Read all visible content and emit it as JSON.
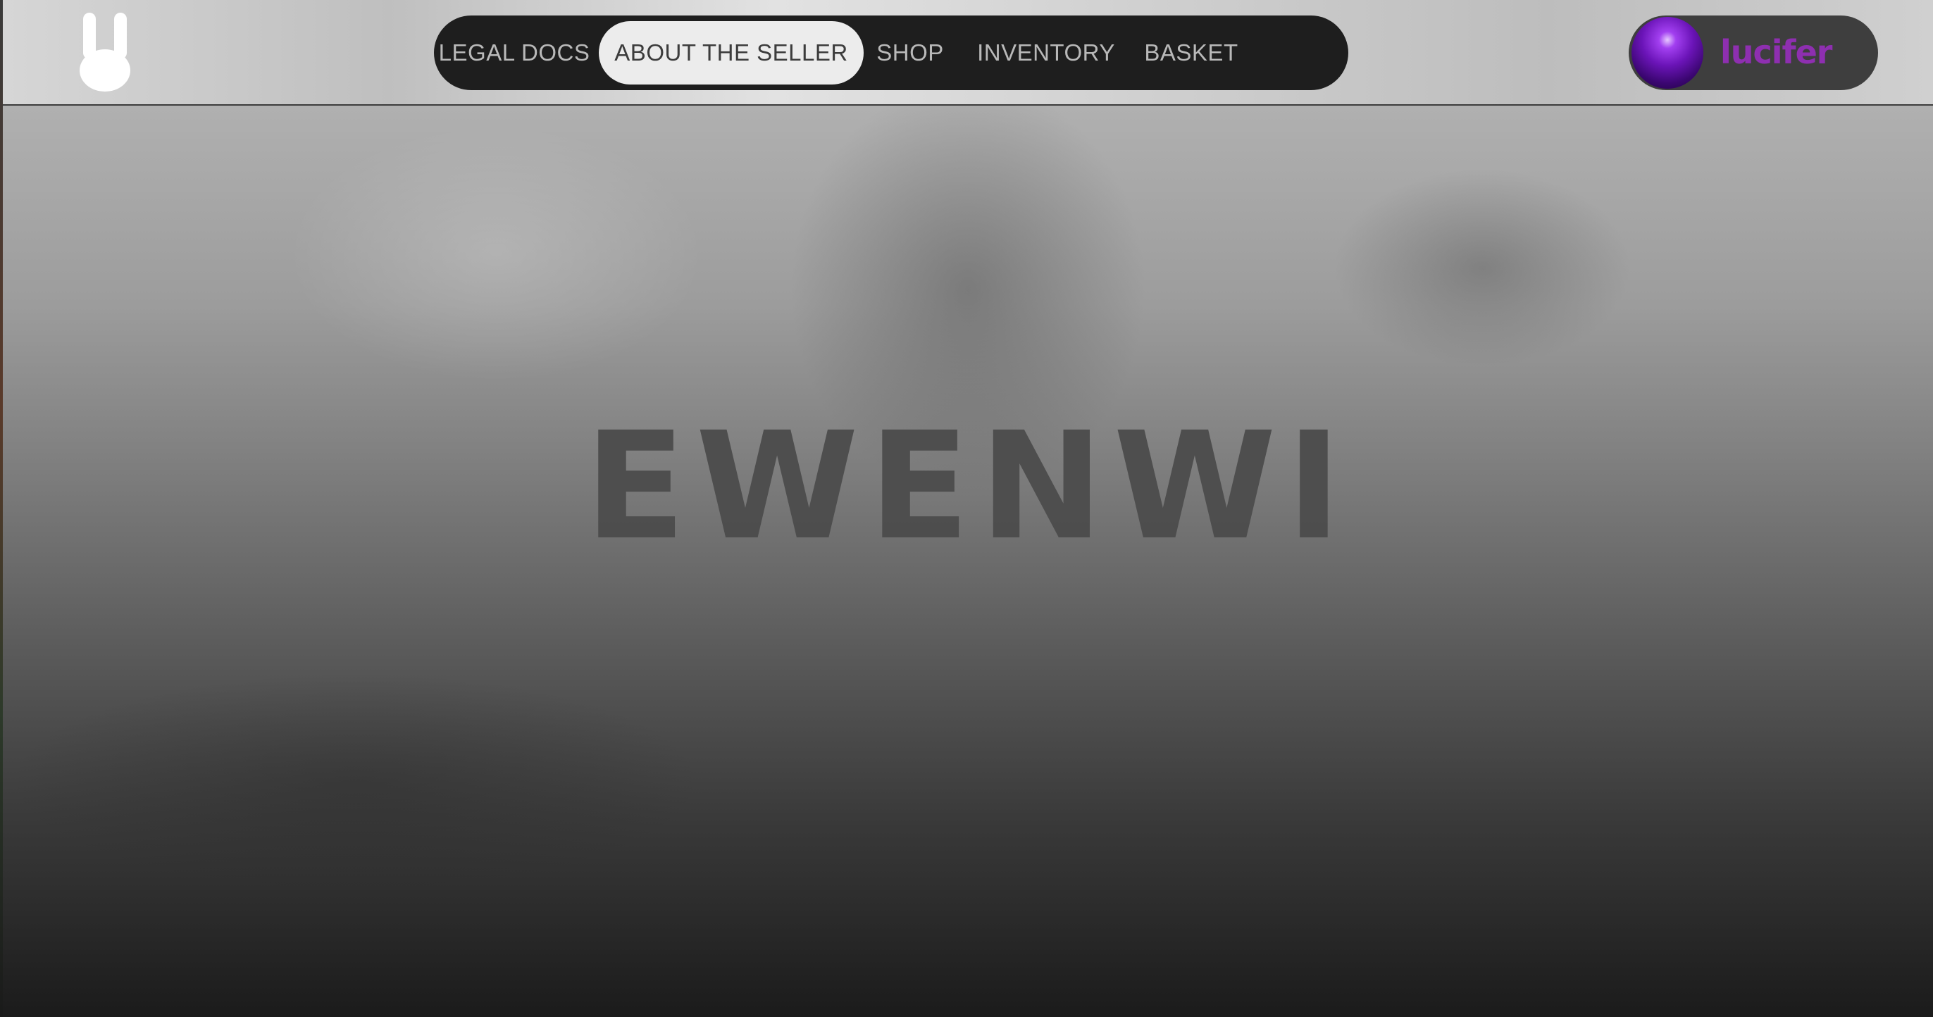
{
  "header": {
    "logo": {
      "icon": "bunny-icon",
      "color": "#ffffff"
    },
    "nav": {
      "items": [
        {
          "label": "LEGAL DOCS",
          "active": false
        },
        {
          "label": "ABOUT THE SELLER",
          "active": true
        },
        {
          "label": "SHOP",
          "active": false
        },
        {
          "label": "INVENTORY",
          "active": false
        },
        {
          "label": "BASKET",
          "active": false
        }
      ]
    },
    "user": {
      "avatar_icon": "purple-orb-icon",
      "name": "lucifer",
      "name_color": "#8e2fb0"
    }
  },
  "hero": {
    "brand_text": "EWENWI"
  },
  "colors": {
    "nav_bg": "#1e1e1e",
    "nav_active_bg": "#ececec",
    "nav_text": "#b9b9b9"
  }
}
